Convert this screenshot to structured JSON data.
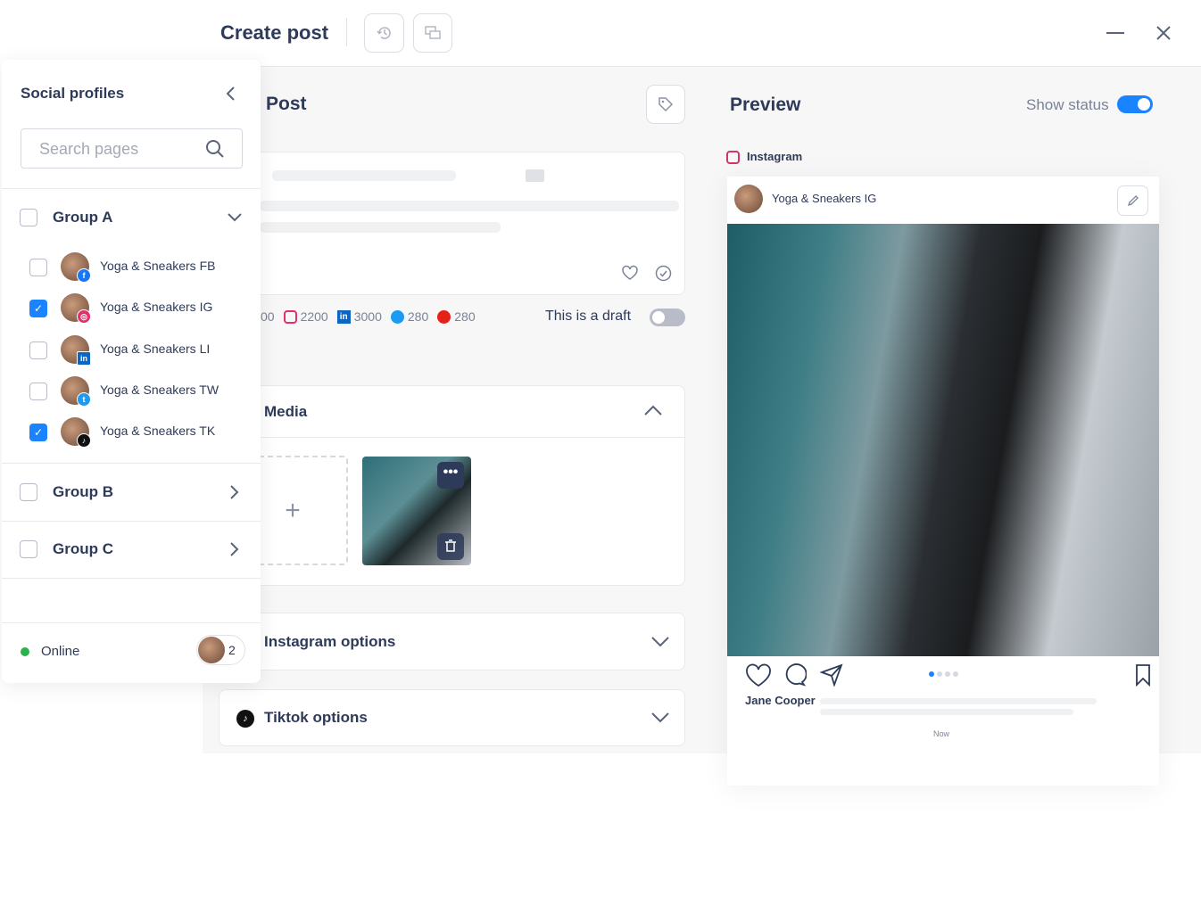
{
  "header": {
    "title": "Create post",
    "history_icon": "history-icon",
    "comments_icon": "comments-icon",
    "minimize_icon": "minimize-icon",
    "close_icon": "close-icon"
  },
  "sidebar": {
    "title": "Social profiles",
    "search_placeholder": "Search pages",
    "groups": [
      {
        "label": "Group A",
        "expanded": true,
        "checked": false,
        "items": [
          {
            "label": "Yoga & Sneakers FB",
            "network": "facebook",
            "checked": false
          },
          {
            "label": "Yoga & Sneakers IG",
            "network": "instagram",
            "checked": true
          },
          {
            "label": "Yoga & Sneakers LI",
            "network": "linkedin",
            "checked": false
          },
          {
            "label": "Yoga & Sneakers TW",
            "network": "twitter",
            "checked": false
          },
          {
            "label": "Yoga & Sneakers TK",
            "network": "tiktok",
            "checked": true
          }
        ]
      },
      {
        "label": "Group B",
        "expanded": false,
        "checked": false
      },
      {
        "label": "Group C",
        "expanded": false,
        "checked": false
      }
    ],
    "status": "Online",
    "online_count": "2",
    "status_color": "#2bb24c"
  },
  "post": {
    "title": "Post",
    "counters": [
      {
        "network": "unknown",
        "value": "00"
      },
      {
        "network": "instagram",
        "value": "2200"
      },
      {
        "network": "linkedin",
        "value": "3000"
      },
      {
        "network": "twitter",
        "value": "280"
      },
      {
        "network": "youtube",
        "value": "280"
      }
    ],
    "draft_label": "This is a draft",
    "draft_on": false,
    "media_title": "Media",
    "instagram_options": "Instagram options",
    "tiktok_options": "Tiktok options"
  },
  "preview": {
    "title": "Preview",
    "show_status": "Show status",
    "show_status_on": true,
    "network": "Instagram",
    "account": "Yoga & Sneakers IG",
    "username": "Jane Cooper",
    "time": "Now",
    "carousel_index": 1,
    "carousel_total": 4
  },
  "colors": {
    "accent": "#1a83ff",
    "text": "#2e3a59",
    "background": "#f7f7f8"
  }
}
